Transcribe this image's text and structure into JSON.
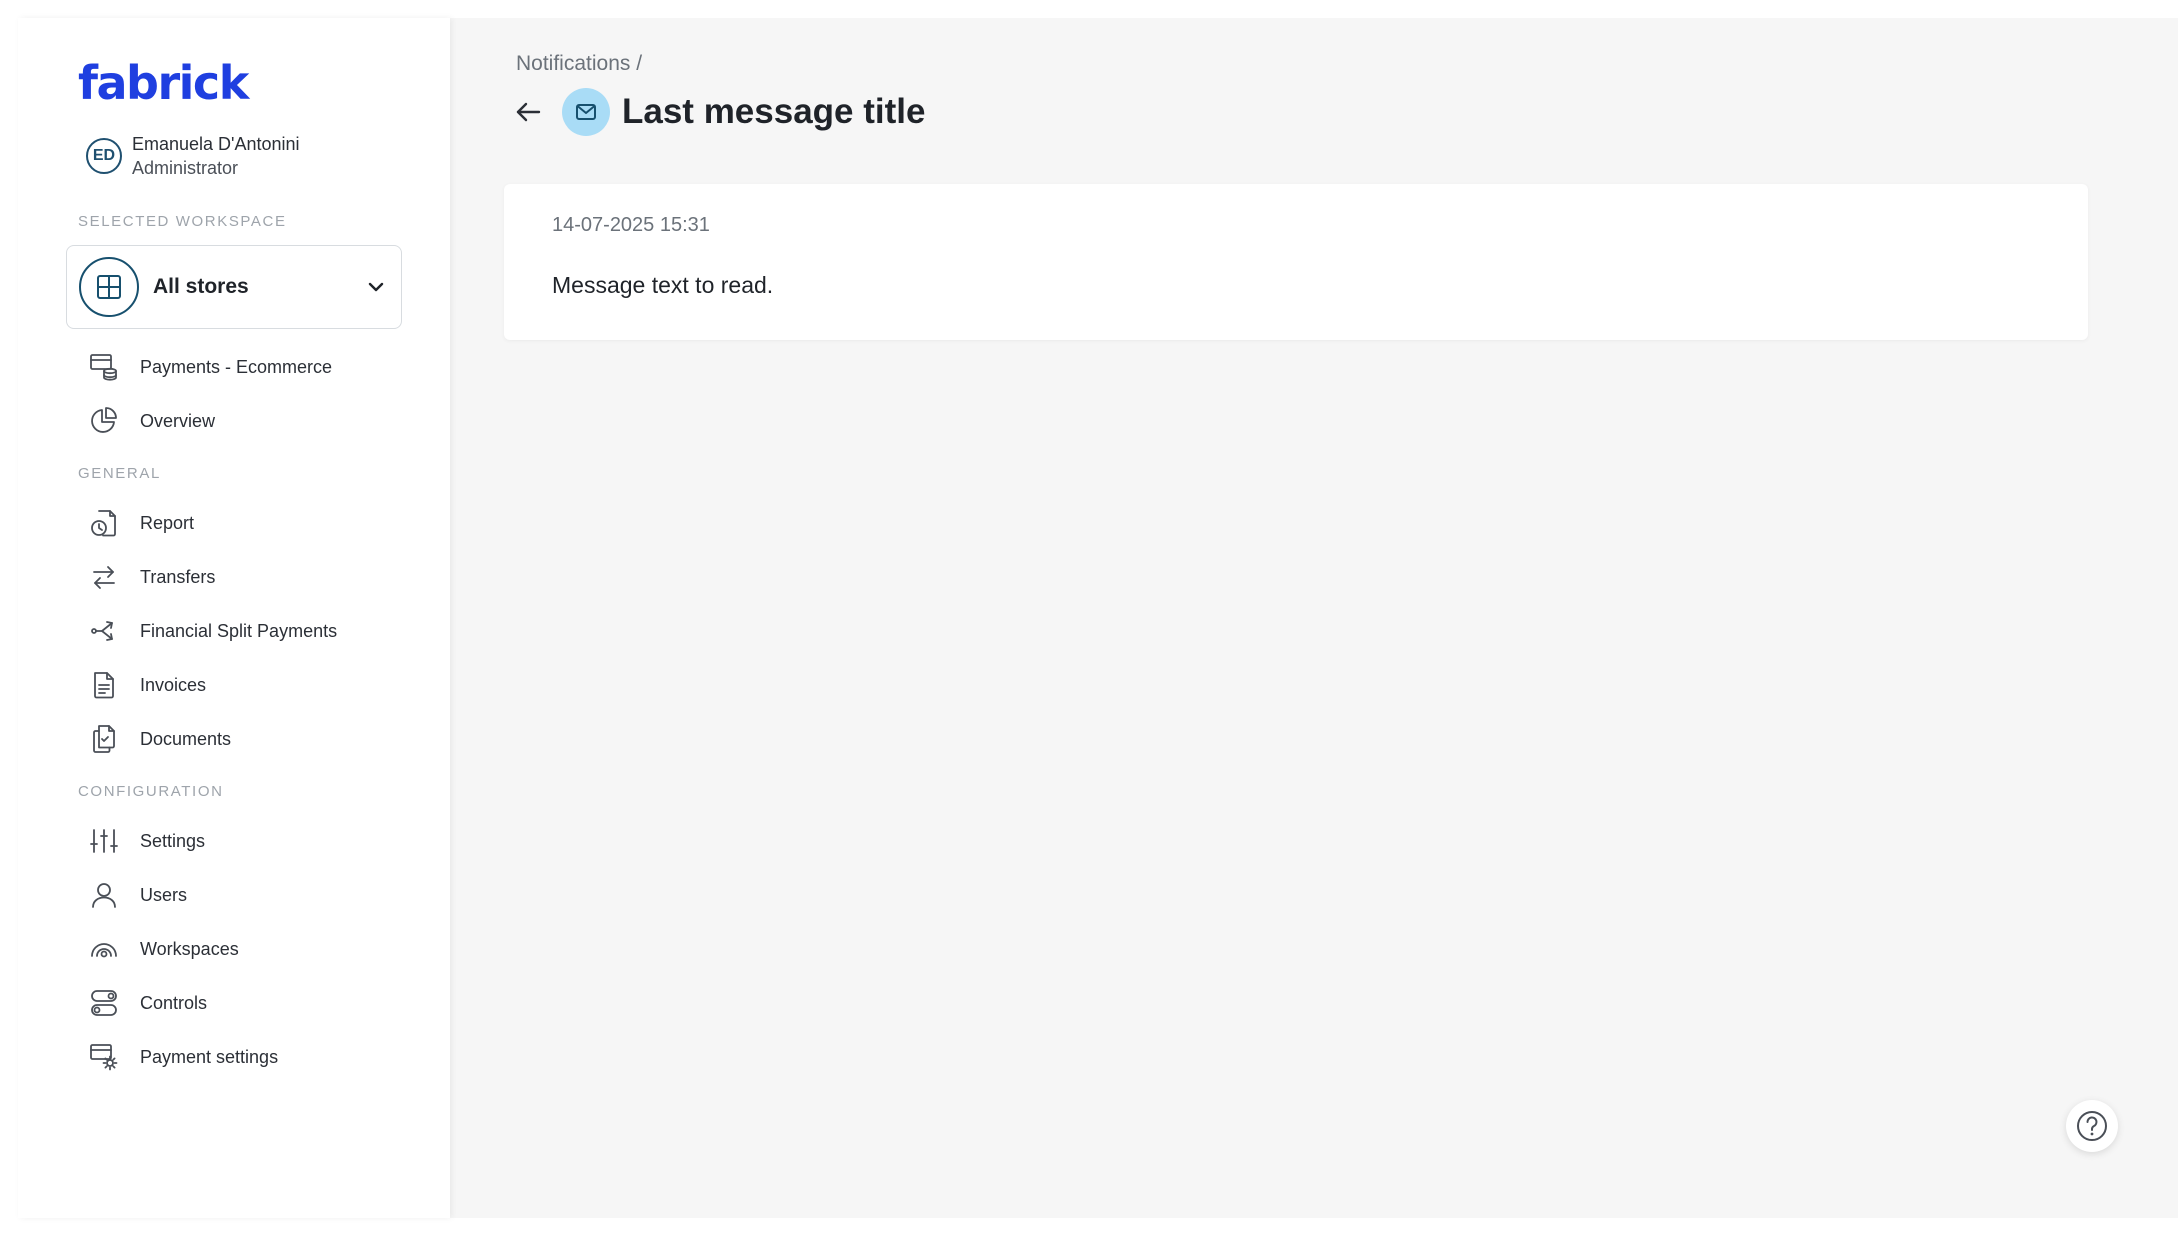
{
  "brand": {
    "logo_text": "fabrick",
    "color": "#1f3fe0"
  },
  "user": {
    "initials": "ED",
    "name": "Emanuela D'Antonini",
    "role": "Administrator"
  },
  "workspace": {
    "section_label": "Selected workspace",
    "selected": "All stores"
  },
  "nav": {
    "top_items": [
      {
        "label": "Payments - Ecommerce",
        "icon": "payments-icon"
      },
      {
        "label": "Overview",
        "icon": "pie-chart-icon"
      }
    ],
    "general_label": "General",
    "general_items": [
      {
        "label": "Report",
        "icon": "report-icon"
      },
      {
        "label": "Transfers",
        "icon": "transfers-icon"
      },
      {
        "label": "Financial Split Payments",
        "icon": "split-icon"
      },
      {
        "label": "Invoices",
        "icon": "invoice-icon"
      },
      {
        "label": "Documents",
        "icon": "documents-icon"
      }
    ],
    "configuration_label": "Configuration",
    "configuration_items": [
      {
        "label": "Settings",
        "icon": "sliders-icon"
      },
      {
        "label": "Users",
        "icon": "user-icon"
      },
      {
        "label": "Workspaces",
        "icon": "workspaces-icon"
      },
      {
        "label": "Controls",
        "icon": "controls-icon"
      },
      {
        "label": "Payment settings",
        "icon": "payment-settings-icon"
      }
    ]
  },
  "main": {
    "breadcrumb": "Notifications /",
    "title": "Last message title",
    "message": {
      "date": "14-07-2025 15:31",
      "text": "Message text to read."
    }
  },
  "colors": {
    "accent": "#1f3fe0",
    "mail_bubble": "#a9dcf6",
    "background": "#f6f6f6"
  }
}
